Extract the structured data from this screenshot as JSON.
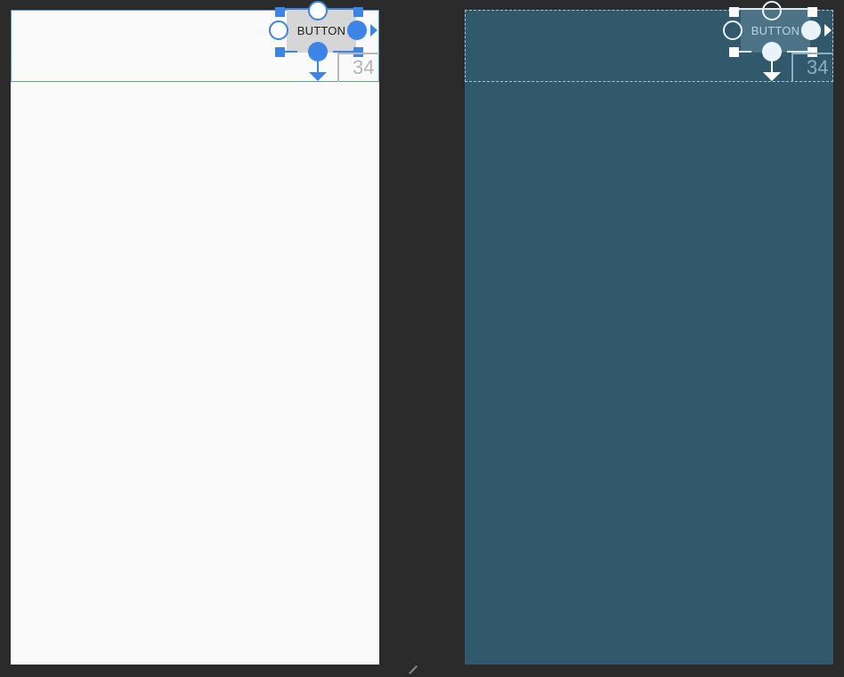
{
  "design_view": {
    "button": {
      "label": "BUTTON"
    },
    "margin_number": "34"
  },
  "blueprint_view": {
    "button": {
      "label": "BUTTON"
    },
    "margin_number": "34"
  },
  "colors": {
    "workspace_bg": "#2b2b2b",
    "design_surface": "#fafafa",
    "blueprint_surface": "#32596b",
    "selection_blue": "#3d84e6"
  },
  "icons": {
    "constraint_anchor": "circle",
    "resize_handle": "square",
    "constraint_arrow": "triangle"
  }
}
